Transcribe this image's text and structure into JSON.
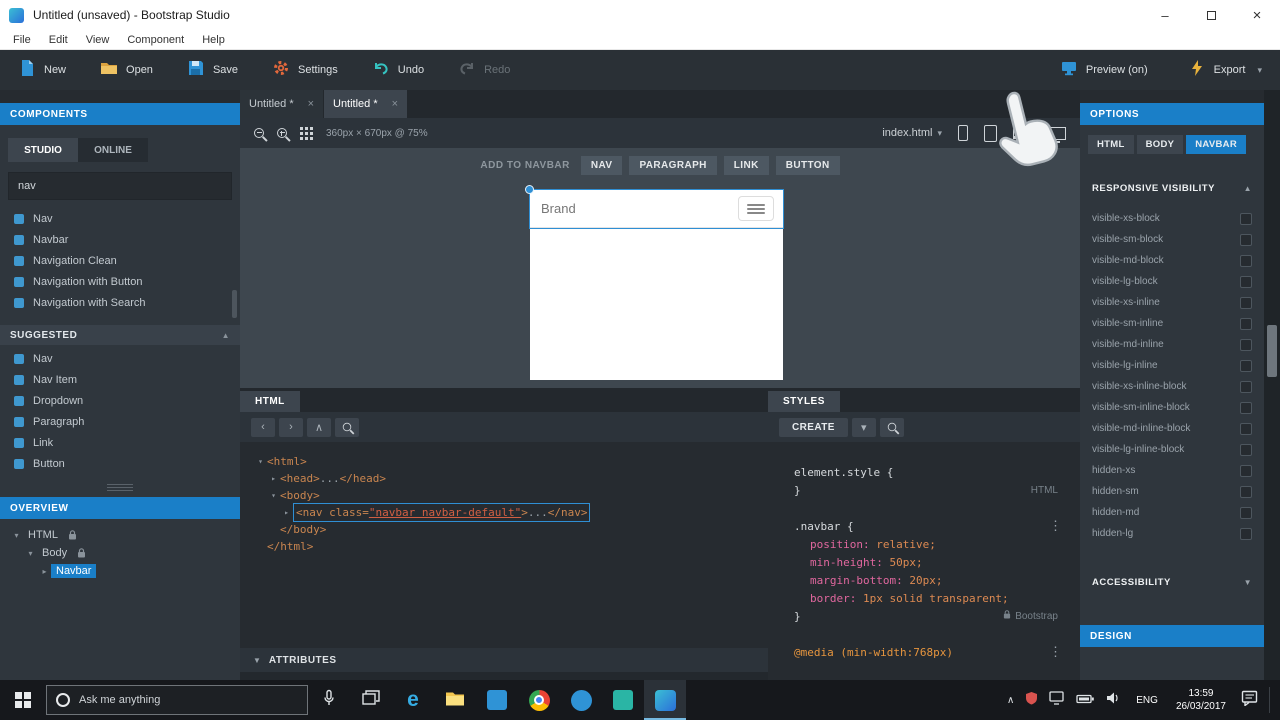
{
  "titlebar": {
    "title": "Untitled (unsaved) - Bootstrap Studio",
    "minimize": "–",
    "close": "×"
  },
  "menubar": {
    "items": [
      "File",
      "Edit",
      "View",
      "Component",
      "Help"
    ]
  },
  "toolbar": {
    "buttons": [
      {
        "label": "New"
      },
      {
        "label": "Open"
      },
      {
        "label": "Save"
      },
      {
        "label": "Settings"
      },
      {
        "label": "Undo"
      },
      {
        "label": "Redo",
        "disabled": true
      }
    ],
    "preview_label": "Preview (on)",
    "export_label": "Export"
  },
  "components": {
    "header": "COMPONENTS",
    "tabs": [
      {
        "label": "STUDIO",
        "active": true
      },
      {
        "label": "ONLINE"
      }
    ],
    "search_value": "nav",
    "items": [
      "Nav",
      "Navbar",
      "Navigation Clean",
      "Navigation with Button",
      "Navigation with Search"
    ],
    "suggested": {
      "header": "SUGGESTED",
      "items": [
        "Nav",
        "Nav Item",
        "Dropdown",
        "Paragraph",
        "Link",
        "Button"
      ]
    }
  },
  "overview": {
    "header": "OVERVIEW",
    "nodes": [
      {
        "label": "HTML",
        "arrow": "▾",
        "pad": 10,
        "locked": true
      },
      {
        "label": "Body",
        "arrow": "▾",
        "pad": 24,
        "locked": true
      },
      {
        "label": "Navbar",
        "arrow": "▸",
        "pad": 38,
        "selected": true
      }
    ]
  },
  "editor": {
    "tabs": [
      {
        "label": "Untitled *"
      },
      {
        "label": "Untitled *",
        "active": true
      }
    ],
    "size_label": "360px × 670px @ 75%",
    "file_name": "index.html",
    "addbar": {
      "label": "ADD TO NAVBAR",
      "buttons": [
        "NAV",
        "PARAGRAPH",
        "LINK",
        "BUTTON"
      ]
    },
    "page": {
      "brand": "Brand"
    }
  },
  "html_panel": {
    "tab": "HTML",
    "attributes_label": "ATTRIBUTES",
    "lines": [
      {
        "indent": 0,
        "arrow": "▾",
        "parts": [
          {
            "t": "<html>",
            "c": "tag"
          }
        ]
      },
      {
        "indent": 1,
        "arrow": "▸",
        "parts": [
          {
            "t": "<head>",
            "c": "tag"
          },
          {
            "t": "...",
            "c": "dots"
          },
          {
            "t": "</head>",
            "c": "tag"
          }
        ]
      },
      {
        "indent": 1,
        "arrow": "▾",
        "parts": [
          {
            "t": "<body>",
            "c": "tag"
          }
        ]
      },
      {
        "indent": 2,
        "arrow": "▸",
        "selected": true,
        "parts": [
          {
            "t": "<nav ",
            "c": "tag"
          },
          {
            "t": "class=",
            "c": "attr"
          },
          {
            "t": "\"navbar navbar-default\"",
            "c": "str"
          },
          {
            "t": ">",
            "c": "tag"
          },
          {
            "t": "...",
            "c": "dots"
          },
          {
            "t": "</nav>",
            "c": "tag"
          }
        ]
      },
      {
        "indent": 1,
        "arrow": "",
        "parts": [
          {
            "t": "</body>",
            "c": "tag"
          }
        ]
      },
      {
        "indent": 0,
        "arrow": "",
        "parts": [
          {
            "t": "</html>",
            "c": "tag"
          }
        ]
      }
    ]
  },
  "styles_panel": {
    "tab": "STYLES",
    "create_label": "CREATE",
    "blocks": [
      {
        "selector": "element.style {",
        "close": "}",
        "badge": "HTML",
        "menu": false,
        "props": []
      },
      {
        "selector": ".navbar {",
        "close": "}",
        "badge": "Bootstrap",
        "badge_lock": true,
        "menu": true,
        "props": [
          [
            "position",
            "relative"
          ],
          [
            "min-height",
            "50px"
          ],
          [
            "margin-bottom",
            "20px"
          ],
          [
            "border",
            "1px solid transparent"
          ]
        ]
      },
      {
        "selector": "@media (min-width:768px)",
        "media": true,
        "menu": true,
        "props": []
      }
    ]
  },
  "options": {
    "header": "OPTIONS",
    "tabs": [
      {
        "label": "HTML"
      },
      {
        "label": "BODY"
      },
      {
        "label": "NAVBAR",
        "active": true
      }
    ],
    "responsive": {
      "title": "RESPONSIVE VISIBILITY",
      "items": [
        "visible-xs-block",
        "visible-sm-block",
        "visible-md-block",
        "visible-lg-block",
        "visible-xs-inline",
        "visible-sm-inline",
        "visible-md-inline",
        "visible-lg-inline",
        "visible-xs-inline-block",
        "visible-sm-inline-block",
        "visible-md-inline-block",
        "visible-lg-inline-block",
        "hidden-xs",
        "hidden-sm",
        "hidden-md",
        "hidden-lg"
      ]
    },
    "accessibility": {
      "title": "ACCESSIBILITY"
    },
    "design": {
      "title": "DESIGN"
    }
  },
  "taskbar": {
    "search_placeholder": "Ask me anything",
    "tray": {
      "lang": "ENG",
      "time": "13:59",
      "date": "26/03/2017"
    }
  },
  "glyphs": {
    "close": "×",
    "caret_down": "▾",
    "menu_up": "▲",
    "menu_down": "▼",
    "kebab": "⋮",
    "back": "‹",
    "fwd": "›",
    "collapse": "∧",
    "tray_caret": "∧"
  },
  "colors": {
    "accent": "#1a7fc8",
    "selection": "#2f8fd4"
  }
}
